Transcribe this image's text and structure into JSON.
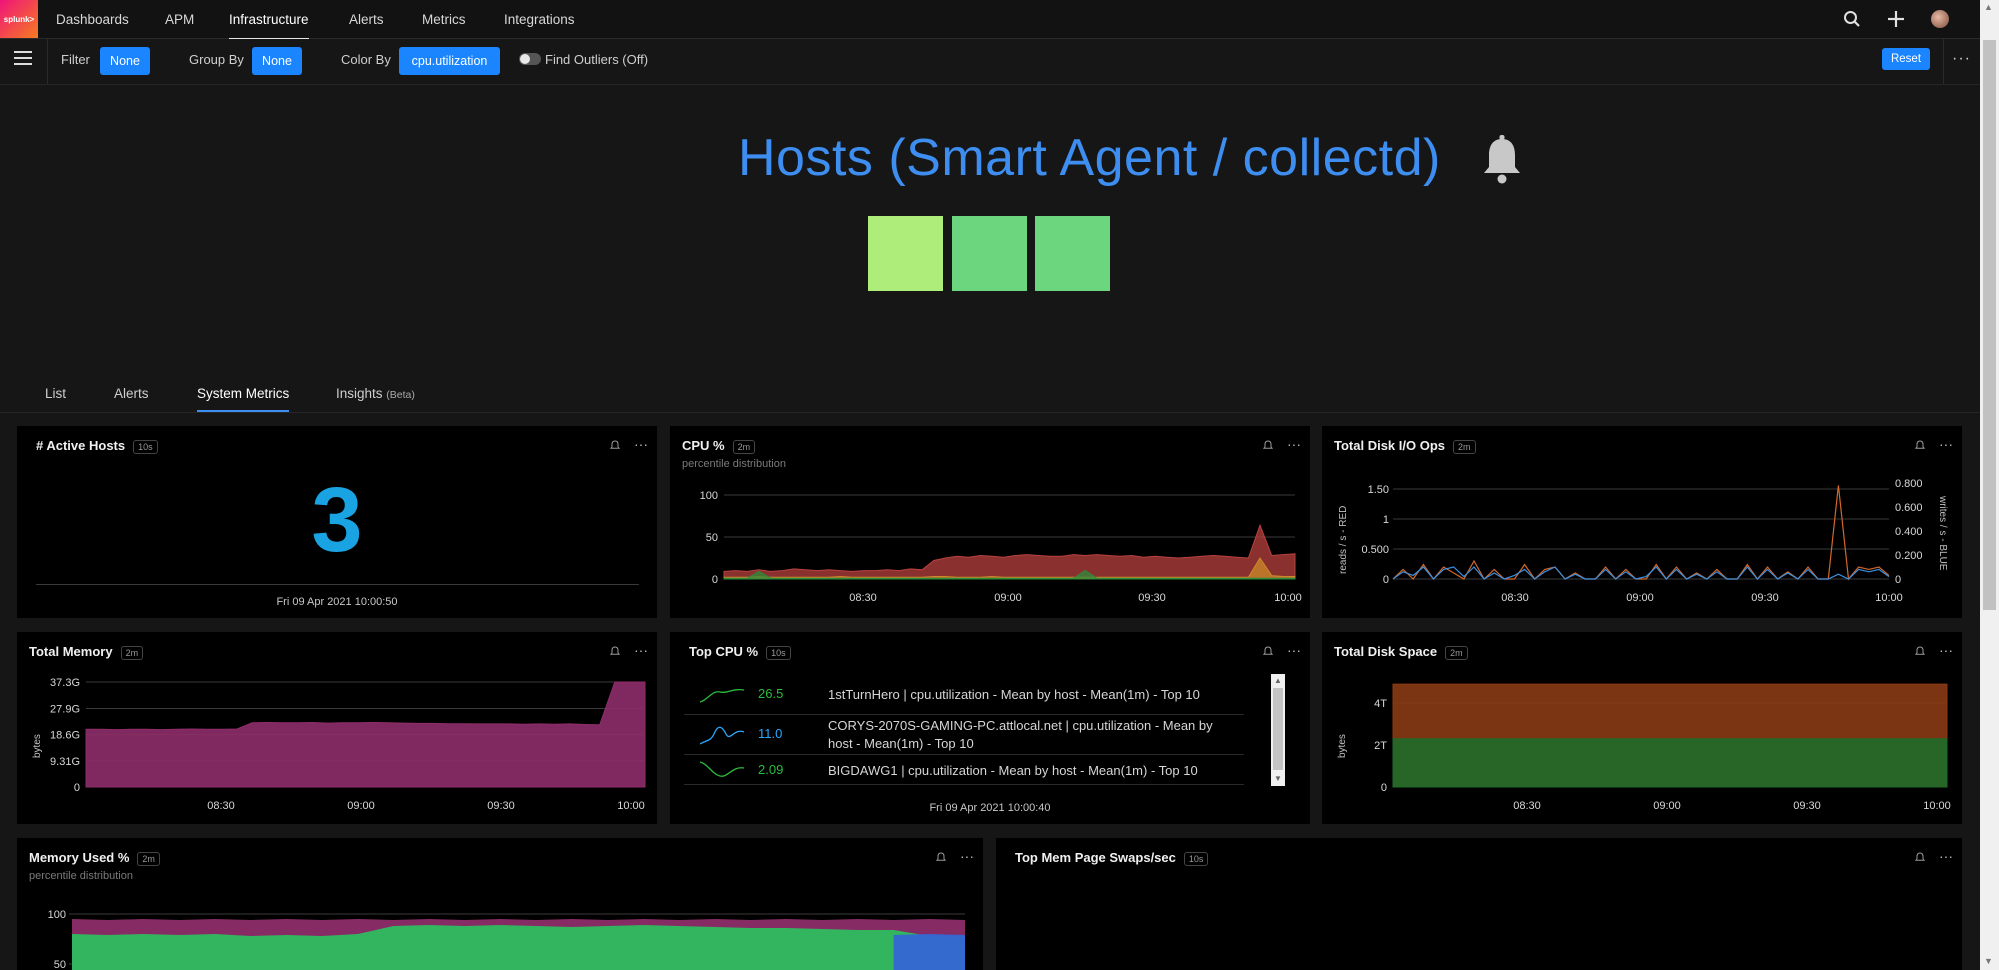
{
  "nav": {
    "logo": "splunk>",
    "items": [
      "Dashboards",
      "APM",
      "Infrastructure",
      "Alerts",
      "Metrics",
      "Integrations"
    ]
  },
  "filterbar": {
    "filter_label": "Filter",
    "filter_value": "None",
    "groupby_label": "Group By",
    "groupby_value": "None",
    "colorby_label": "Color By",
    "colorby_value": "cpu.utilization",
    "outliers_label": "Find Outliers (Off)",
    "reset_label": "Reset"
  },
  "hero": {
    "title": "Hosts (Smart Agent / collectd)",
    "hosts_colors": [
      "#aeed7a",
      "#6bd67d",
      "#6bd67d"
    ]
  },
  "tabs": [
    "List",
    "Alerts",
    "System Metrics",
    "Insights"
  ],
  "tabs_beta": "(Beta)",
  "panels": {
    "active_hosts": {
      "title": "# Active Hosts",
      "badge": "10s",
      "value": "3",
      "timestamp": "Fri 09 Apr 2021 10:00:50"
    },
    "cpu": {
      "title": "CPU %",
      "badge": "2m",
      "subtitle": "percentile distribution"
    },
    "disk_io": {
      "title": "Total Disk I/O Ops",
      "badge": "2m",
      "left_label": "reads / s - RED",
      "right_label": "writes / s - BLUE"
    },
    "memory": {
      "title": "Total Memory",
      "badge": "2m",
      "ylabel": "bytes"
    },
    "top_cpu": {
      "title": "Top CPU %",
      "badge": "10s",
      "timestamp": "Fri 09 Apr 2021 10:00:40",
      "rows": [
        {
          "value": "26.5",
          "value_color": "#2bbb3c",
          "desc": "1stTurnHero | cpu.utilization - Mean by host - Mean(1m) - Top 10"
        },
        {
          "value": "11.0",
          "value_color": "#29a8ff",
          "desc": "CORYS-2070S-GAMING-PC.attlocal.net | cpu.utilization - Mean by host - Mean(1m) - Top 10"
        },
        {
          "value": "2.09",
          "value_color": "#2bbb3c",
          "desc": "BIGDAWG1 | cpu.utilization - Mean by host - Mean(1m) - Top 10"
        }
      ]
    },
    "disk_space": {
      "title": "Total Disk Space",
      "badge": "2m",
      "ylabel": "bytes"
    },
    "mem_used": {
      "title": "Memory Used %",
      "badge": "2m",
      "subtitle": "percentile distribution"
    },
    "mem_swaps": {
      "title": "Top Mem Page Swaps/sec",
      "badge": "10s"
    }
  },
  "chart_data": [
    {
      "type": "area",
      "title": "CPU %",
      "x": [
        "08:30",
        "09:00",
        "09:30",
        "10:00"
      ],
      "yticks": [
        0,
        50,
        100
      ],
      "ylim": [
        0,
        100
      ],
      "series": [
        {
          "color": "#b8413f",
          "values": [
            9,
            10,
            9,
            11,
            9,
            10,
            12,
            11,
            10,
            11,
            10,
            9,
            10,
            10,
            11,
            10,
            12,
            11,
            22,
            25,
            27,
            26,
            28,
            27,
            26,
            28,
            29,
            28,
            27,
            27,
            29,
            28,
            29,
            28,
            27,
            28,
            26,
            27,
            26,
            25,
            26,
            27,
            28,
            27,
            26,
            25,
            64,
            28,
            29,
            30
          ]
        },
        {
          "color": "#cc8a2a",
          "values": [
            2,
            2,
            2,
            3,
            2,
            2,
            2,
            2,
            2,
            2,
            3,
            2,
            2,
            2,
            2,
            2,
            2,
            2,
            3,
            3,
            2,
            2,
            2,
            3,
            2,
            2,
            2,
            2,
            2,
            2,
            2,
            2,
            2,
            2,
            2,
            2,
            2,
            2,
            2,
            2,
            2,
            2,
            2,
            2,
            2,
            2,
            25,
            4,
            3,
            3
          ]
        },
        {
          "color": "#2e8b3a",
          "values": [
            1,
            1,
            1,
            9,
            1,
            1,
            1,
            1,
            1,
            1,
            1,
            1,
            1,
            1,
            1,
            1,
            1,
            1,
            1,
            1,
            1,
            1,
            1,
            1,
            1,
            1,
            1,
            1,
            1,
            1,
            1,
            10,
            1,
            1,
            1,
            1,
            1,
            1,
            1,
            1,
            1,
            1,
            1,
            1,
            1,
            1,
            1,
            1,
            1,
            1
          ]
        }
      ]
    },
    {
      "type": "line",
      "title": "Total Disk I/O Ops",
      "x": [
        "08:30",
        "09:00",
        "09:30",
        "10:00"
      ],
      "yticks_left": [
        "0",
        "0.500",
        "1",
        "1.50"
      ],
      "ylim_left": [
        0,
        1.7
      ],
      "yticks_right": [
        "0",
        "0.200",
        "0.400",
        "0.600",
        "0.800"
      ],
      "ylim_right": [
        0,
        0.85
      ],
      "series": [
        {
          "color": "#d2682b",
          "values": [
            0,
            0.08,
            0,
            0.12,
            0,
            0.1,
            0.05,
            0,
            0.15,
            0,
            0.08,
            0,
            0,
            0.12,
            0,
            0.08,
            0.1,
            0,
            0.05,
            0,
            0,
            0.1,
            0,
            0.08,
            0,
            0,
            0.12,
            0,
            0.1,
            0,
            0.05,
            0,
            0.08,
            0,
            0,
            0.12,
            0,
            0.1,
            0,
            0.06,
            0,
            0.1,
            0,
            0,
            0.78,
            0,
            0.1,
            0.08,
            0.1,
            0.03
          ]
        },
        {
          "color": "#3b8fe0",
          "values": [
            0,
            0.06,
            0.03,
            0.1,
            0,
            0.08,
            0.1,
            0.02,
            0.1,
            0,
            0.05,
            0,
            0.03,
            0.08,
            0,
            0.06,
            0.1,
            0,
            0.04,
            0,
            0,
            0.08,
            0,
            0.06,
            0,
            0.02,
            0.1,
            0,
            0.08,
            0,
            0.04,
            0,
            0.06,
            0,
            0,
            0.1,
            0,
            0.08,
            0,
            0.05,
            0,
            0.08,
            0,
            0,
            0.04,
            0,
            0.08,
            0.06,
            0.08,
            0.02
          ]
        }
      ]
    },
    {
      "type": "area",
      "title": "Total Memory",
      "x": [
        "08:30",
        "09:00",
        "09:30",
        "10:00"
      ],
      "yticks": [
        "0",
        "9.31G",
        "18.6G",
        "27.9G",
        "37.3G"
      ],
      "ylim": [
        0,
        37.3
      ],
      "series": [
        {
          "color": "#8e2d6a",
          "values": [
            20.5,
            20.5,
            20.4,
            20.5,
            20.5,
            20.4,
            20.5,
            20.6,
            20.5,
            20.5,
            20.6,
            22.8,
            22.9,
            22.8,
            22.8,
            22.9,
            22.7,
            22.8,
            22.8,
            22.9,
            22.8,
            22.7,
            22.6,
            22.6,
            22.5,
            22.5,
            22.4,
            22.4,
            22.4,
            22.3,
            22.4,
            22.3,
            22.4,
            22.2,
            22.1,
            37.8,
            37.5,
            37.5
          ]
        }
      ]
    },
    {
      "type": "area",
      "title": "Total Disk Space",
      "x": [
        "08:30",
        "09:00",
        "09:30",
        "10:00"
      ],
      "yticks": [
        "0",
        "2T",
        "4T"
      ],
      "ylim": [
        0,
        5
      ],
      "series": [
        {
          "color": "#8a3b14",
          "values": [
            4.9,
            4.9
          ]
        },
        {
          "color": "#1f6b2a",
          "values": [
            2.3,
            2.3
          ]
        }
      ]
    },
    {
      "type": "area",
      "title": "Memory Used %",
      "yticks": [
        50,
        100
      ],
      "ylim": [
        0,
        100
      ],
      "series": [
        {
          "color": "#8e2d6a",
          "values": [
            95,
            94,
            95,
            94,
            95,
            94,
            95,
            94,
            95,
            94,
            95,
            94,
            95,
            94,
            95,
            94,
            95,
            94,
            95,
            94,
            95,
            94,
            95,
            94,
            95,
            94
          ]
        },
        {
          "color": "#2ebc5f",
          "values": [
            80,
            79,
            80,
            79,
            80,
            78,
            79,
            78,
            80,
            88,
            89,
            88,
            89,
            88,
            87,
            88,
            89,
            88,
            87,
            86,
            86,
            85,
            84,
            84,
            78,
            77
          ]
        },
        {
          "color": "#3566d4",
          "values": [
            0,
            0,
            0,
            0,
            0,
            0,
            0,
            0,
            0,
            0,
            0,
            0,
            0,
            0,
            0,
            0,
            0,
            0,
            0,
            0,
            0,
            0,
            0,
            0,
            80,
            79
          ]
        }
      ]
    }
  ]
}
